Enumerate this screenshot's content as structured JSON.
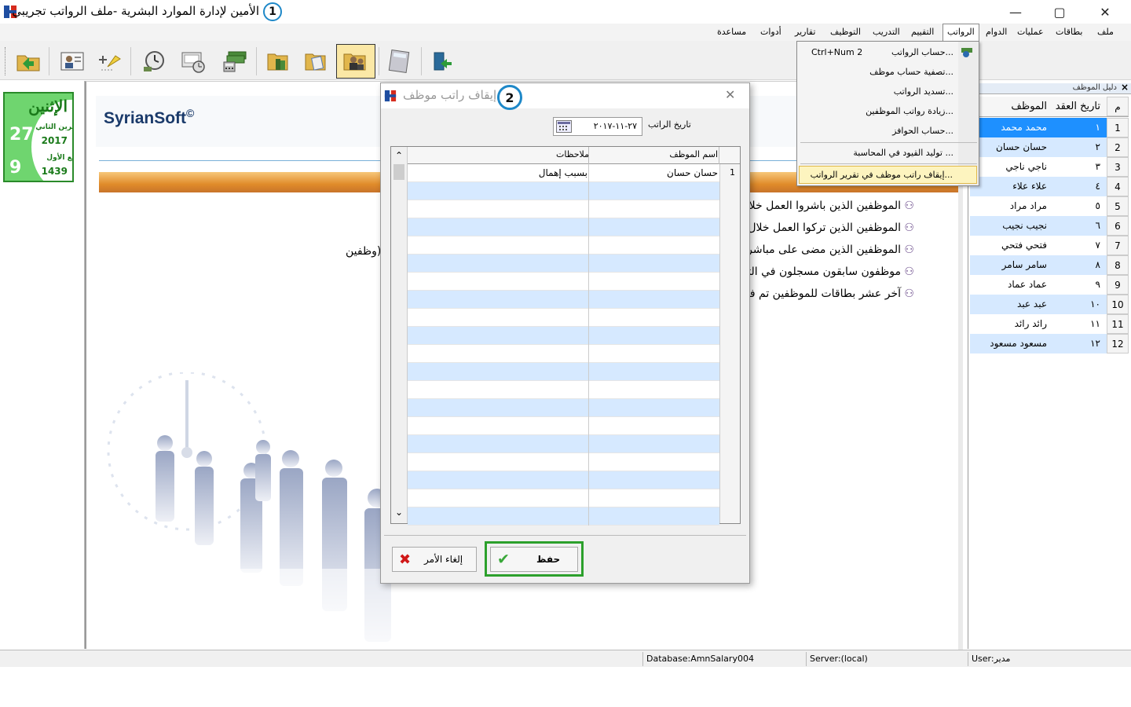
{
  "window": {
    "title": "الأمين لإدارة الموارد البشرية -ملف الرواتب تجريبي",
    "badge1": "1",
    "minimize": "—",
    "maximize": "▢",
    "close": "✕"
  },
  "menu": [
    "ملف",
    "بطاقات",
    "عمليات",
    "الدوام",
    "الرواتب",
    "التقييم",
    "التدريب",
    "التوظيف",
    "تقارير",
    "أدوات",
    "مساعدة"
  ],
  "toolbar_icons": [
    "folder-exit-icon",
    "employee-card-icon",
    "add-assistant-icon",
    "clock-icon",
    "attendance-clock-icon",
    "money-stack-icon",
    "books-icon",
    "documents-icon",
    "employees-users-icon",
    "calculator-icon",
    "books-exit-icon"
  ],
  "calendar": {
    "day_name": "الإثنين",
    "greg_day": "27",
    "greg_month": "تشرين الثاني",
    "greg_year": "2017",
    "hijri_day": "9",
    "hijri_month": "ربيع الأول",
    "hijri_year": "1439"
  },
  "workspace": {
    "brand": "SyrianSoft",
    "brand_mark": "©",
    "links": [
      "الموظفين الذين باشروا العمل خلا",
      "الموظفين الذين تركوا العمل خلال",
      "الموظفين الذين مضى على مباشرت",
      "موظفون سابقون مسجلون في التر",
      "آخر عشر بطاقات للموظفين تم فتح"
    ],
    "fragment_text": "وظفين)"
  },
  "employee_guide": {
    "title": "دليل الموظف",
    "close": "×",
    "headers": {
      "num": "م",
      "date": "تاريخ العقد",
      "employee": "الموظف"
    },
    "rows": [
      {
        "num": "1",
        "date": "١",
        "employee": "محمد محمد"
      },
      {
        "num": "2",
        "date": "٢",
        "employee": "حسان حسان"
      },
      {
        "num": "3",
        "date": "٣",
        "employee": "ناجي ناجي"
      },
      {
        "num": "4",
        "date": "٤",
        "employee": "علاء علاء"
      },
      {
        "num": "5",
        "date": "٥",
        "employee": "مراد مراد"
      },
      {
        "num": "6",
        "date": "٦",
        "employee": "نجيب نجيب"
      },
      {
        "num": "7",
        "date": "٧",
        "employee": "فتحي فتحي"
      },
      {
        "num": "8",
        "date": "٨",
        "employee": "سامر سامر"
      },
      {
        "num": "9",
        "date": "٩",
        "employee": "عماد عماد"
      },
      {
        "num": "10",
        "date": "١٠",
        "employee": "عبد عبد"
      },
      {
        "num": "11",
        "date": "١١",
        "employee": "رائد رائد"
      },
      {
        "num": "12",
        "date": "١٢",
        "employee": "مسعود مسعود"
      }
    ]
  },
  "salaries_menu": {
    "items": [
      {
        "label": "حساب الرواتب...",
        "shortcut": "Ctrl+Num 2"
      },
      {
        "label": "تصفية حساب موظف...",
        "shortcut": ""
      },
      {
        "label": "تسديد الرواتب...",
        "shortcut": ""
      },
      {
        "label": "زيادة رواتب الموظفين...",
        "shortcut": ""
      },
      {
        "label": "حساب الحوافز...",
        "shortcut": ""
      },
      {
        "label": "توليد القيود في المحاسبة ...",
        "shortcut": ""
      },
      {
        "label": "إيقاف راتب موظف في تقرير الرواتب...",
        "shortcut": ""
      }
    ]
  },
  "dialog": {
    "title": "إيقاف راتب موظف",
    "badge2": "2",
    "close": "✕",
    "date_label": "تاريخ الراتب",
    "date_value": "٢٧-١١-٢٠١٧",
    "columns": {
      "name": "اسم الموظف",
      "notes": "ملاحظات"
    },
    "rows": [
      {
        "num": "1",
        "name": "حسان حسان",
        "notes": "بسبب إهمال"
      }
    ],
    "save_label": "حفظ",
    "cancel_label": "إلغاء الأمر",
    "scroll_up": "⌃",
    "scroll_down": "⌄"
  },
  "status": {
    "database": "Database:AmnSalary004",
    "server": "Server:(local)",
    "user": "User:مدير"
  },
  "colors": {
    "selected_row": "#1e90ff",
    "alt_row": "#d6e9ff",
    "calendar_bg": "#6fd56f",
    "highlight": "#2ca02c",
    "badge_ring": "#1e88c8"
  }
}
